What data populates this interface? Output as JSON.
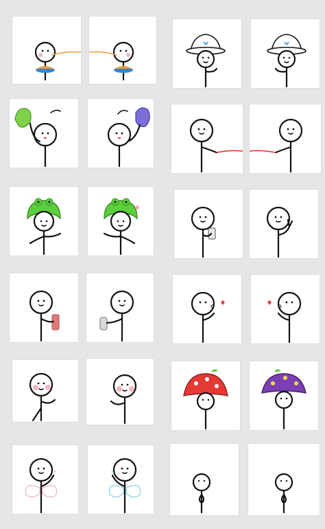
{
  "page": {
    "background": "#e6e6e6",
    "tile_color": "#ffffff"
  },
  "stickers": [
    {
      "id": 1,
      "icon": "stick-figure-eating-noodles-left",
      "accent": "#f29b3a"
    },
    {
      "id": 2,
      "icon": "stick-figure-eating-noodles-right",
      "accent": "#f29b3a"
    },
    {
      "id": 3,
      "icon": "stick-figure-bucket-hat-left",
      "accent": "#4aa3df"
    },
    {
      "id": 4,
      "icon": "stick-figure-bucket-hat-right",
      "accent": "#4aa3df"
    },
    {
      "id": 5,
      "icon": "stick-figure-green-puppet",
      "accent": "#7fd14a"
    },
    {
      "id": 6,
      "icon": "stick-figure-purple-puppet",
      "accent": "#7b6fd8"
    },
    {
      "id": 7,
      "icon": "stick-figure-red-string-left",
      "accent": "#d93a3a"
    },
    {
      "id": 8,
      "icon": "stick-figure-red-string-right",
      "accent": "#d93a3a"
    },
    {
      "id": 9,
      "icon": "stick-figure-frog-hat-left",
      "accent": "#5ccf3c"
    },
    {
      "id": 10,
      "icon": "stick-figure-frog-hat-right",
      "accent": "#5ccf3c"
    },
    {
      "id": 11,
      "icon": "stick-figure-phone",
      "accent": "#cccccc"
    },
    {
      "id": 12,
      "icon": "stick-figure-peace-sign",
      "accent": "#111111"
    },
    {
      "id": 13,
      "icon": "stick-figure-red-phone",
      "accent": "#e07a7a"
    },
    {
      "id": 14,
      "icon": "stick-figure-pastry",
      "accent": "#d9d9d9"
    },
    {
      "id": 15,
      "icon": "stick-figure-kiss-left",
      "accent": "#e53935"
    },
    {
      "id": 16,
      "icon": "stick-figure-kiss-right",
      "accent": "#e53935"
    },
    {
      "id": 17,
      "icon": "stick-figure-blush-left",
      "accent": "#f4a7b5"
    },
    {
      "id": 18,
      "icon": "stick-figure-blush-right",
      "accent": "#f4a7b5"
    },
    {
      "id": 19,
      "icon": "stick-figure-red-mushroom-hat",
      "accent": "#e53935"
    },
    {
      "id": 20,
      "icon": "stick-figure-purple-mushroom-hat",
      "accent": "#7b3fb3"
    },
    {
      "id": 21,
      "icon": "stick-figure-pink-fairy-wings",
      "accent": "#f0b8d6"
    },
    {
      "id": 22,
      "icon": "stick-figure-blue-fairy-wings",
      "accent": "#8fd3e8"
    },
    {
      "id": 23,
      "icon": "stick-figure-shy-left",
      "accent": "#111111"
    },
    {
      "id": 24,
      "icon": "stick-figure-shy-right",
      "accent": "#111111"
    }
  ]
}
